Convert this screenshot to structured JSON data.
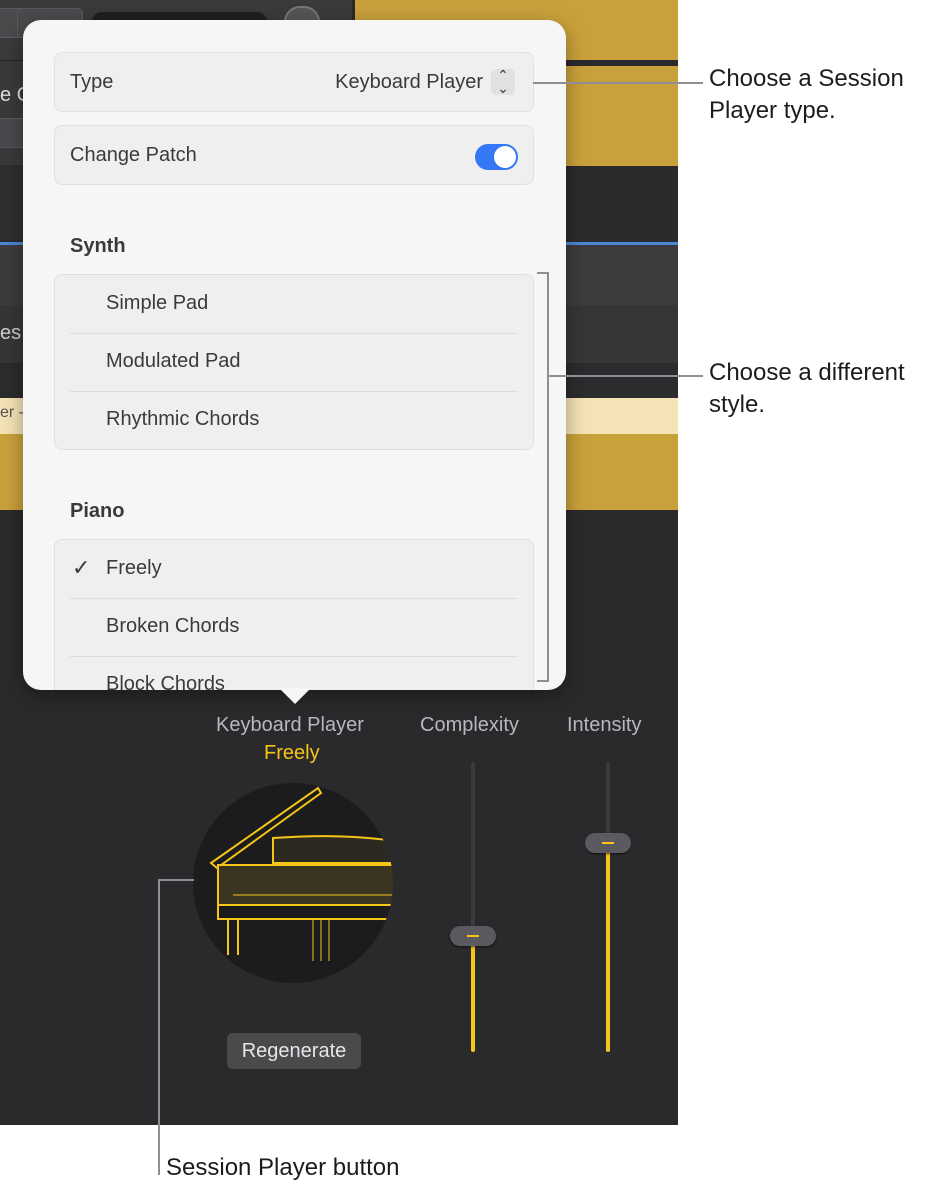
{
  "popover": {
    "type_label": "Type",
    "type_value": "Keyboard Player",
    "type_stepper": "⌃⌄",
    "change_patch_label": "Change Patch",
    "change_patch_on": true,
    "sections": [
      {
        "title": "Synth",
        "items": [
          {
            "label": "Simple Pad",
            "checked": false
          },
          {
            "label": "Modulated Pad",
            "checked": false
          },
          {
            "label": "Rhythmic Chords",
            "checked": false
          }
        ]
      },
      {
        "title": "Piano",
        "items": [
          {
            "label": "Freely",
            "checked": true
          },
          {
            "label": "Broken Chords",
            "checked": false
          },
          {
            "label": "Block Chords",
            "checked": false
          }
        ]
      }
    ],
    "check_glyph": "✓"
  },
  "player": {
    "title": "Keyboard Player",
    "style": "Freely",
    "regenerate_label": "Regenerate",
    "complexity_label": "Complexity",
    "intensity_label": "Intensity",
    "complexity_value": 0.4,
    "intensity_value": 0.72,
    "accent_color": "#f5c518"
  },
  "background": {
    "partial_texts": [
      "e G",
      "es",
      "er -"
    ]
  },
  "callouts": {
    "type": "Choose a Session Player type.",
    "style": "Choose a different style.",
    "button": "Session Player button"
  }
}
